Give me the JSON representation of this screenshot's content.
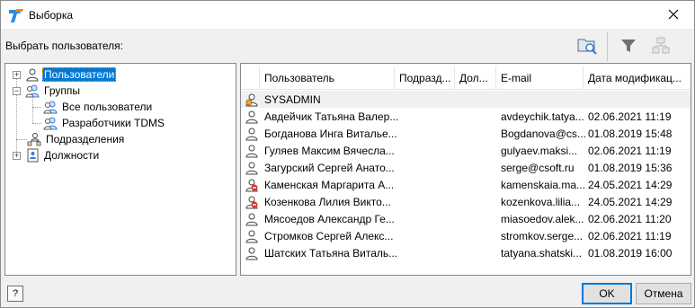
{
  "window": {
    "title": "Выборка"
  },
  "toolbar": {
    "label": "Выбрать пользователя:",
    "icons": [
      "find-user-icon",
      "filter-icon",
      "structure-icon"
    ]
  },
  "tree": {
    "items": [
      {
        "label": "Пользователи",
        "icon": "user-icon",
        "selected": true
      },
      {
        "label": "Группы",
        "icon": "group-icon"
      },
      {
        "label": "Все пользователи",
        "icon": "group-icon"
      },
      {
        "label": "Разработчики TDMS",
        "icon": "group-icon"
      },
      {
        "label": "Подразделения",
        "icon": "org-icon"
      },
      {
        "label": "Должности",
        "icon": "position-icon"
      }
    ]
  },
  "list": {
    "columns": [
      "Пользователь",
      "Подразд...",
      "Дол...",
      "E-mail",
      "Дата модификац..."
    ],
    "rows": [
      {
        "name": "SYSADMIN",
        "dept": "",
        "pos": "",
        "email": "",
        "date": "",
        "icon": "admin-icon"
      },
      {
        "name": "Авдейчик Татьяна Валер...",
        "dept": "",
        "pos": "",
        "email": "avdeychik.tatya...",
        "date": "02.06.2021 11:19",
        "icon": "user-icon"
      },
      {
        "name": "Богданова Инга Виталье...",
        "dept": "",
        "pos": "",
        "email": "Bogdanova@cs...",
        "date": "01.08.2019 15:48",
        "icon": "user-icon"
      },
      {
        "name": "Гуляев Максим Вячесла...",
        "dept": "",
        "pos": "",
        "email": "gulyaev.maksi...",
        "date": "02.06.2021 11:19",
        "icon": "user-icon"
      },
      {
        "name": "Загурский Сергей Анато...",
        "dept": "",
        "pos": "",
        "email": "serge@csoft.ru",
        "date": "01.08.2019 15:36",
        "icon": "user-icon"
      },
      {
        "name": "Каменская Маргарита А...",
        "dept": "",
        "pos": "",
        "email": "kamenskaia.ma...",
        "date": "24.05.2021 14:29",
        "icon": "user-blocked-icon"
      },
      {
        "name": "Козенкова Лилия Викто...",
        "dept": "",
        "pos": "",
        "email": "kozenkova.lilia...",
        "date": "24.05.2021 14:29",
        "icon": "user-blocked-icon"
      },
      {
        "name": "Мясоедов Александр Ге...",
        "dept": "",
        "pos": "",
        "email": "miasoedov.alek...",
        "date": "02.06.2021 11:20",
        "icon": "user-icon"
      },
      {
        "name": "Стромков Сергей Алекс...",
        "dept": "",
        "pos": "",
        "email": "stromkov.serge...",
        "date": "02.06.2021 11:19",
        "icon": "user-icon"
      },
      {
        "name": "Шатских Татьяна Виталь...",
        "dept": "",
        "pos": "",
        "email": "tatyana.shatski...",
        "date": "01.08.2019 16:00",
        "icon": "user-icon"
      }
    ]
  },
  "footer": {
    "help": "?",
    "ok": "OK",
    "cancel": "Отмена"
  },
  "colors": {
    "selection": "#0078d7",
    "blocked": "#d9302c",
    "admin": "#e8a33a"
  }
}
